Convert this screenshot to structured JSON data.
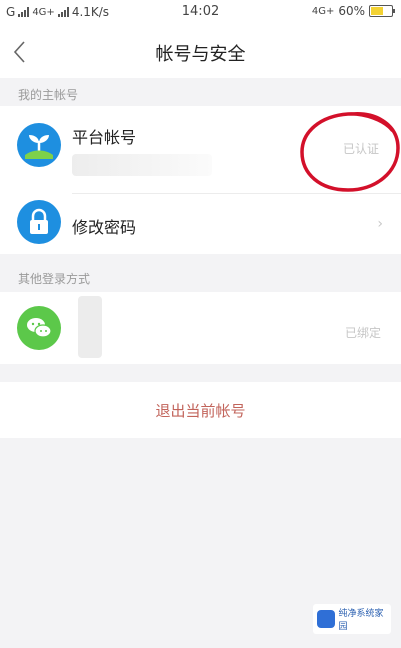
{
  "status_bar": {
    "carrier": "G",
    "network": "4G+",
    "speed": "4.1K/s",
    "time": "14:02",
    "network_right": "4G+",
    "battery_label": "60%",
    "battery_level": 0.6,
    "battery_color": "#f3d233"
  },
  "nav": {
    "back_icon": "chevron-left-icon",
    "title": "帐号与安全"
  },
  "sections": {
    "main_account_header": "我的主帐号",
    "other_login_header": "其他登录方式"
  },
  "account_row": {
    "icon": "platform-logo-icon",
    "label": "平台帐号",
    "status": "已认证"
  },
  "password_row": {
    "icon": "lock-icon",
    "label": "修改密码",
    "chevron": "›"
  },
  "wechat_row": {
    "icon": "wechat-icon",
    "status": "已绑定"
  },
  "logout": {
    "label": "退出当前帐号"
  },
  "watermark": {
    "text": "纯净系统家园"
  },
  "colors": {
    "accent_blue": "#1e8fe0",
    "wechat_green": "#5cc84a",
    "logout_red": "#c2645b",
    "annotation_red": "#d3102a"
  }
}
